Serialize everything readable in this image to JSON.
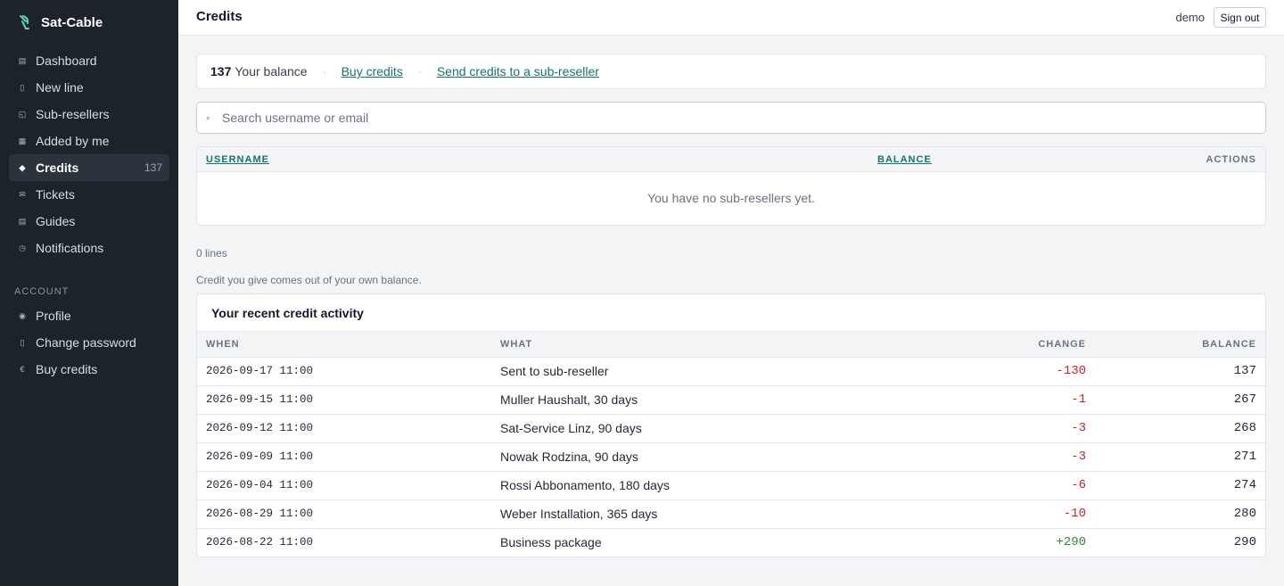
{
  "app": {
    "name": "Sat-Cable"
  },
  "sidebar": {
    "items": [
      {
        "label": "Dashboard",
        "icon": "▤",
        "name": "dashboard"
      },
      {
        "label": "New line",
        "icon": "▯",
        "name": "new-line"
      },
      {
        "label": "Sub-resellers",
        "icon": "◱",
        "name": "sub-resellers"
      },
      {
        "label": "Added by me",
        "icon": "▦",
        "name": "added-by-me"
      },
      {
        "label": "Credits",
        "icon": "◆",
        "name": "credits",
        "badge": "137",
        "active": true
      },
      {
        "label": "Tickets",
        "icon": "✉",
        "name": "tickets"
      },
      {
        "label": "Guides",
        "icon": "▤",
        "name": "guides"
      },
      {
        "label": "Notifications",
        "icon": "◷",
        "name": "notifications"
      }
    ],
    "account_section": "ACCOUNT",
    "account_items": [
      {
        "label": "Profile",
        "icon": "◉",
        "name": "profile"
      },
      {
        "label": "Change password",
        "icon": "▯",
        "name": "change-password"
      },
      {
        "label": "Buy credits",
        "icon": "€",
        "name": "buy-credits"
      }
    ]
  },
  "header": {
    "title": "Credits",
    "user": "demo",
    "signout_label": "Sign out"
  },
  "balance": {
    "amount": "137",
    "label": "Your balance",
    "separator": "·",
    "buy_link": "Buy credits",
    "send_link": "Send credits to a sub-reseller"
  },
  "search": {
    "icon": "⌕",
    "placeholder": "Search username or email",
    "value": ""
  },
  "subresellers_table": {
    "col_username": "USERNAME",
    "col_balance": "BALANCE",
    "col_actions": "ACTIONS",
    "empty_message": "You have no sub-resellers yet."
  },
  "lines_count": "0 lines",
  "note": "Credit you give comes out of your own balance.",
  "activity": {
    "title": "Your recent credit activity",
    "columns": {
      "when": "WHEN",
      "what": "WHAT",
      "change": "CHANGE",
      "balance": "BALANCE"
    },
    "rows": [
      {
        "when": "2026-09-17 11:00",
        "what": "Sent to sub-reseller",
        "change": "-130",
        "balance": "137",
        "positive": false
      },
      {
        "when": "2026-09-15 11:00",
        "what": "Muller Haushalt, 30 days",
        "change": "-1",
        "balance": "267",
        "positive": false
      },
      {
        "when": "2026-09-12 11:00",
        "what": "Sat-Service Linz, 90 days",
        "change": "-3",
        "balance": "268",
        "positive": false
      },
      {
        "when": "2026-09-09 11:00",
        "what": "Nowak Rodzina, 90 days",
        "change": "-3",
        "balance": "271",
        "positive": false
      },
      {
        "when": "2026-09-04 11:00",
        "what": "Rossi Abbonamento, 180 days",
        "change": "-6",
        "balance": "274",
        "positive": false
      },
      {
        "when": "2026-08-29 11:00",
        "what": "Weber Installation, 365 days",
        "change": "-10",
        "balance": "280",
        "positive": false
      },
      {
        "when": "2026-08-22 11:00",
        "what": "Business package",
        "change": "+290",
        "balance": "290",
        "positive": true
      }
    ]
  },
  "colors": {
    "sidebar_bg": "#1c232b",
    "accent_link": "#14756a",
    "brand_icon": "#5fd3b0",
    "negative": "#c0272d",
    "positive": "#2f8a3c"
  }
}
